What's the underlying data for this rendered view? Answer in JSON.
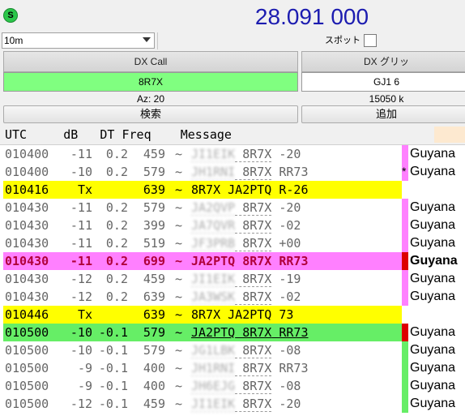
{
  "top": {
    "status_badge": "S",
    "frequency": "28.091 000",
    "band": "10m",
    "spot_label": "スポット"
  },
  "dx": {
    "call_header": "DX Call",
    "grid_header": "DX グリッ",
    "call_value": "8R7X",
    "grid_value": "GJ1 6",
    "azimuth": "Az: 20",
    "distance": "15050 k",
    "lookup_label": "検索",
    "add_label": "追加"
  },
  "table": {
    "header": "UTC     dB   DT Freq    Message",
    "colors": {
      "yellow": "#ffff00",
      "magenta": "#ff80ff",
      "red": "#dd0000",
      "green": "#66ee66",
      "tx_row": "#ffff00",
      "reply_row": "#ff80ff",
      "cq_row": "#66ee66"
    },
    "rows": [
      {
        "utc": "010400",
        "db": "-11",
        "dt": "0.2",
        "freq": "459",
        "tilde": "~",
        "call1": "JI1EIK",
        "call2": "8R7X",
        "msg_tail": " -20",
        "country": "Guyana",
        "style": "normal",
        "marker": "magenta",
        "ast": ""
      },
      {
        "utc": "010400",
        "db": "-10",
        "dt": "0.2",
        "freq": "579",
        "tilde": "~",
        "call1": "JH1RNI",
        "call2": "8R7X",
        "msg_tail": " RR73",
        "country": "Guyana",
        "style": "normal",
        "marker": "magenta",
        "ast": "*"
      },
      {
        "utc": "010416",
        "db": "Tx",
        "dt": "",
        "freq": "639",
        "tilde": "~",
        "call1": "8R7X",
        "call2": "JA2PTQ",
        "msg_tail": " R-26",
        "country": "",
        "style": "tx",
        "marker": "",
        "ast": ""
      },
      {
        "utc": "010430",
        "db": "-11",
        "dt": "0.2",
        "freq": "579",
        "tilde": "~",
        "call1": "JA2QVP",
        "call2": "8R7X",
        "msg_tail": " -20",
        "country": "Guyana",
        "style": "normal",
        "marker": "magenta",
        "ast": ""
      },
      {
        "utc": "010430",
        "db": "-11",
        "dt": "0.2",
        "freq": "399",
        "tilde": "~",
        "call1": "JA7QVR",
        "call2": "8R7X",
        "msg_tail": " -02",
        "country": "Guyana",
        "style": "normal",
        "marker": "magenta",
        "ast": ""
      },
      {
        "utc": "010430",
        "db": "-11",
        "dt": "0.2",
        "freq": "519",
        "tilde": "~",
        "call1": "JF3PRB",
        "call2": "8R7X",
        "msg_tail": " +00",
        "country": "Guyana",
        "style": "normal",
        "marker": "magenta",
        "ast": ""
      },
      {
        "utc": "010430",
        "db": "-11",
        "dt": "0.2",
        "freq": "699",
        "tilde": "~",
        "call1": "JA2PTQ",
        "call2": "8R7X",
        "msg_tail": " RR73",
        "country": "Guyana",
        "style": "reply",
        "marker": "red",
        "ast": ""
      },
      {
        "utc": "010430",
        "db": "-12",
        "dt": "0.2",
        "freq": "459",
        "tilde": "~",
        "call1": "JI1EIK",
        "call2": "8R7X",
        "msg_tail": " -19",
        "country": "Guyana",
        "style": "normal",
        "marker": "magenta",
        "ast": ""
      },
      {
        "utc": "010430",
        "db": "-12",
        "dt": "0.2",
        "freq": "639",
        "tilde": "~",
        "call1": "JA3WSK",
        "call2": "8R7X",
        "msg_tail": " -02",
        "country": "Guyana",
        "style": "normal",
        "marker": "magenta",
        "ast": ""
      },
      {
        "utc": "010446",
        "db": "Tx",
        "dt": "",
        "freq": "639",
        "tilde": "~",
        "call1": "8R7X",
        "call2": "JA2PTQ",
        "msg_tail": " 73",
        "country": "",
        "style": "tx",
        "marker": "",
        "ast": ""
      },
      {
        "utc": "010500",
        "db": "-10",
        "dt": "-0.1",
        "freq": "579",
        "tilde": "~",
        "call1": "JA2PTQ",
        "call2": "8R7X",
        "msg_tail": " RR73",
        "country": "Guyana",
        "style": "cq",
        "marker": "red",
        "ast": ""
      },
      {
        "utc": "010500",
        "db": "-10",
        "dt": "-0.1",
        "freq": "579",
        "tilde": "~",
        "call1": "JG1LBK",
        "call2": "8R7X",
        "msg_tail": " -08",
        "country": "Guyana",
        "style": "normal",
        "marker": "green",
        "ast": ""
      },
      {
        "utc": "010500",
        "db": "-9",
        "dt": "-0.1",
        "freq": "400",
        "tilde": "~",
        "call1": "JH1RNI",
        "call2": "8R7X",
        "msg_tail": " RR73",
        "country": "Guyana",
        "style": "normal",
        "marker": "green",
        "ast": ""
      },
      {
        "utc": "010500",
        "db": "-9",
        "dt": "-0.1",
        "freq": "400",
        "tilde": "~",
        "call1": "JH6EJG",
        "call2": "8R7X",
        "msg_tail": " -08",
        "country": "Guyana",
        "style": "normal",
        "marker": "green",
        "ast": ""
      },
      {
        "utc": "010500",
        "db": "-12",
        "dt": "-0.1",
        "freq": "459",
        "tilde": "~",
        "call1": "JI1EIK",
        "call2": "8R7X",
        "msg_tail": " -20",
        "country": "Guyana",
        "style": "normal",
        "marker": "green",
        "ast": ""
      }
    ]
  }
}
